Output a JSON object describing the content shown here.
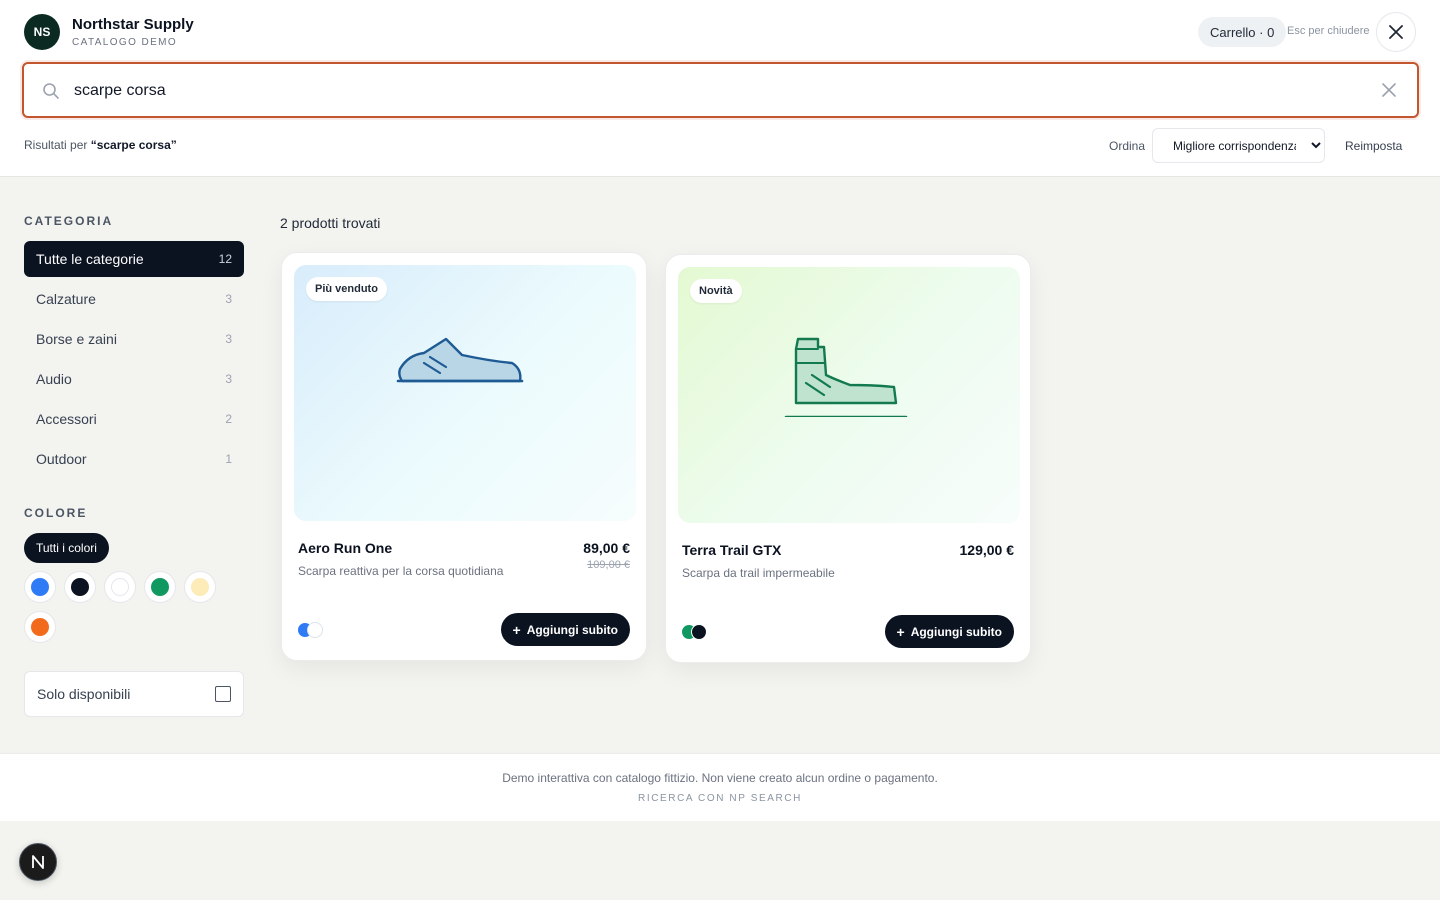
{
  "header": {
    "logo_initials": "NS",
    "brand_name": "Northstar Supply",
    "brand_sub": "CATALOGO DEMO",
    "cart_label": "Carrello · 0",
    "esc_hint": "Esc per chiudere",
    "close_icon": "close-icon"
  },
  "search": {
    "value": "scarpe corsa",
    "icon": "search-icon",
    "clear_icon": "clear-icon"
  },
  "results_bar": {
    "prefix": "Risultati per",
    "query": "“scarpe corsa”",
    "sort_label": "Ordina",
    "sort_selected": "Migliore corrispondenza",
    "reset_label": "Reimposta"
  },
  "sidebar": {
    "category_heading": "CATEGORIA",
    "categories": [
      {
        "label": "Tutte le categorie",
        "count": "12",
        "active": true
      },
      {
        "label": "Calzature",
        "count": "3"
      },
      {
        "label": "Borse e zaini",
        "count": "3"
      },
      {
        "label": "Audio",
        "count": "3"
      },
      {
        "label": "Accessori",
        "count": "2"
      },
      {
        "label": "Outdoor",
        "count": "1"
      }
    ],
    "color_heading": "COLORE",
    "all_colors_label": "Tutti i colori",
    "swatch_colors": [
      "#2f7bf5",
      "#0b1220",
      "#ffffff",
      "#0f9960",
      "#fdebb8",
      "#f26b1d"
    ],
    "available_only_label": "Solo disponibili"
  },
  "results": {
    "count_label": "2 prodotti trovati",
    "products": [
      {
        "badge": "Più venduto",
        "name": "Aero Run One",
        "description": "Scarpa reattiva per la corsa quotidiana",
        "price": "89,00 €",
        "old_price": "109,00 €",
        "add_label": "Aggiungi subito",
        "image_icon": "running-shoe-icon",
        "colors": [
          "#2f7bf5",
          "#ffffff"
        ]
      },
      {
        "badge": "Novità",
        "name": "Terra Trail GTX",
        "description": "Scarpa da trail impermeabile",
        "price": "129,00 €",
        "add_label": "Aggiungi subito",
        "image_icon": "trail-boot-icon",
        "colors": [
          "#0f9960",
          "#0b1220"
        ]
      }
    ]
  },
  "footer": {
    "note": "Demo interattiva con catalogo fittizio. Non viene creato alcun ordine o pagamento.",
    "credit": "RICERCA CON NP SEARCH"
  },
  "fab": {
    "letter": "N"
  },
  "colors": {
    "accent_border": "#c2562f",
    "dark": "#0b1220"
  }
}
